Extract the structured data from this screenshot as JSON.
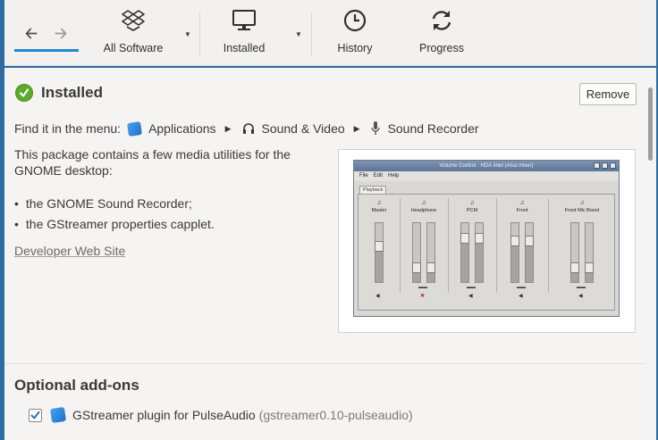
{
  "toolbar": {
    "back_icon": "arrow-left-icon",
    "forward_icon": "arrow-right-icon",
    "all_software": "All Software",
    "installed": "Installed",
    "history": "History",
    "progress": "Progress",
    "accent_color": "#1f8ad2"
  },
  "details": {
    "status": "Installed",
    "status_color": "#5dab28",
    "remove_label": "Remove",
    "menu_prefix": "Find it in the menu:",
    "menu_path": [
      "Applications",
      "Sound & Video",
      "Sound Recorder"
    ],
    "description": "This package contains a few media utilities for the GNOME desktop:",
    "bullets": [
      "the GNOME Sound Recorder;",
      "the GStreamer properties capplet."
    ],
    "website_link": "Developer Web Site"
  },
  "screenshot": {
    "window_title": "Volume Control : HDA Intel (Alsa mixer)",
    "menus": [
      "File",
      "Edit",
      "Help"
    ],
    "tab": "Playback",
    "channels": [
      {
        "name": "Master",
        "stereo": false,
        "level": 0.6,
        "muted": false
      },
      {
        "name": "Headphone",
        "stereo": true,
        "level": 0.25,
        "muted": true
      },
      {
        "name": "PCM",
        "stereo": true,
        "level": 0.75,
        "muted": false
      },
      {
        "name": "Front",
        "stereo": true,
        "level": 0.7,
        "muted": false
      },
      {
        "name": "Front Mic Boost",
        "stereo": true,
        "level": 0.25,
        "muted": false
      }
    ]
  },
  "addons": {
    "title": "Optional add-ons",
    "items": [
      {
        "label": "GStreamer plugin for PulseAudio",
        "package": "(gstreamer0.10-pulseaudio)",
        "checked": true
      }
    ]
  }
}
